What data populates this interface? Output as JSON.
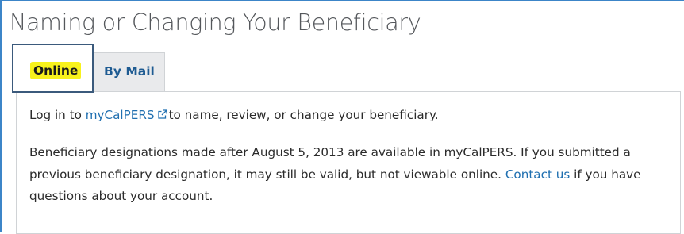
{
  "page": {
    "heading": "Naming or Changing Your Beneficiary"
  },
  "tabs": [
    {
      "label": "Online",
      "selected": true
    },
    {
      "label": "By Mail",
      "selected": false
    }
  ],
  "panel": {
    "p1": {
      "prefix": "Log in to ",
      "link": "myCalPERS",
      "link_icon": "external-link-icon",
      "suffix": "to name, review, or change your beneficiary."
    },
    "p2": {
      "text": "Beneficiary designations made after August 5, 2013 are available in myCalPERS. If you submitted a previous beneficiary designation, it may still be valid, but not viewable online. ",
      "link": "Contact us",
      "suffix": " if you have questions about your account."
    }
  },
  "colors": {
    "accent_border": "#3c85c8",
    "active_tab_border": "#3b5a7c",
    "highlight": "#f8f21c",
    "link": "#1f6fb0"
  }
}
